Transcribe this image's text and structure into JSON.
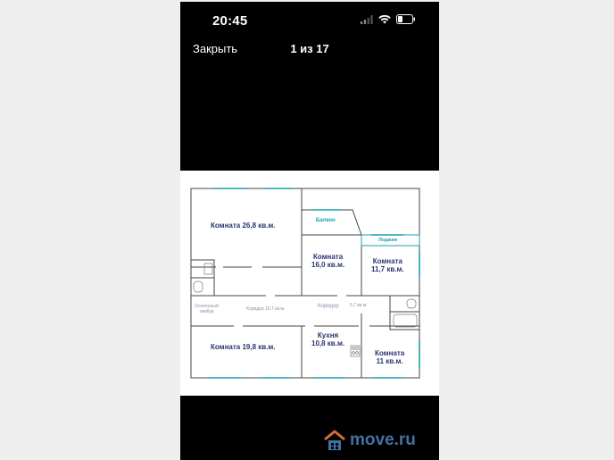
{
  "status": {
    "time": "20:45"
  },
  "nav": {
    "close": "Закрыть",
    "counter": "1 из 17"
  },
  "plan": {
    "rooms": [
      {
        "label": "Комната 26,8 кв.м."
      },
      {
        "label": "Комната\n16,0 кв.м."
      },
      {
        "label": "Комната\n11,7 кв.м."
      },
      {
        "label": "Комната 19,8 кв.м."
      },
      {
        "label": "Кухня\n10,8 кв.м."
      },
      {
        "label": "Комната\n11 кв.м."
      }
    ],
    "balcony": "Балкон",
    "loggia": "Лоджия",
    "vestibule": "Осаленный\nтамбур",
    "corridor1": "Коридор  15,7 кв.м.",
    "corridor2": "Коридор",
    "corridor2_area": "5,7 кв.м."
  },
  "watermark": {
    "text": "move.ru"
  },
  "colors": {
    "plan_text": "#2a3470",
    "teal": "#1aa0b0",
    "watermark": "#4a7fb4"
  }
}
